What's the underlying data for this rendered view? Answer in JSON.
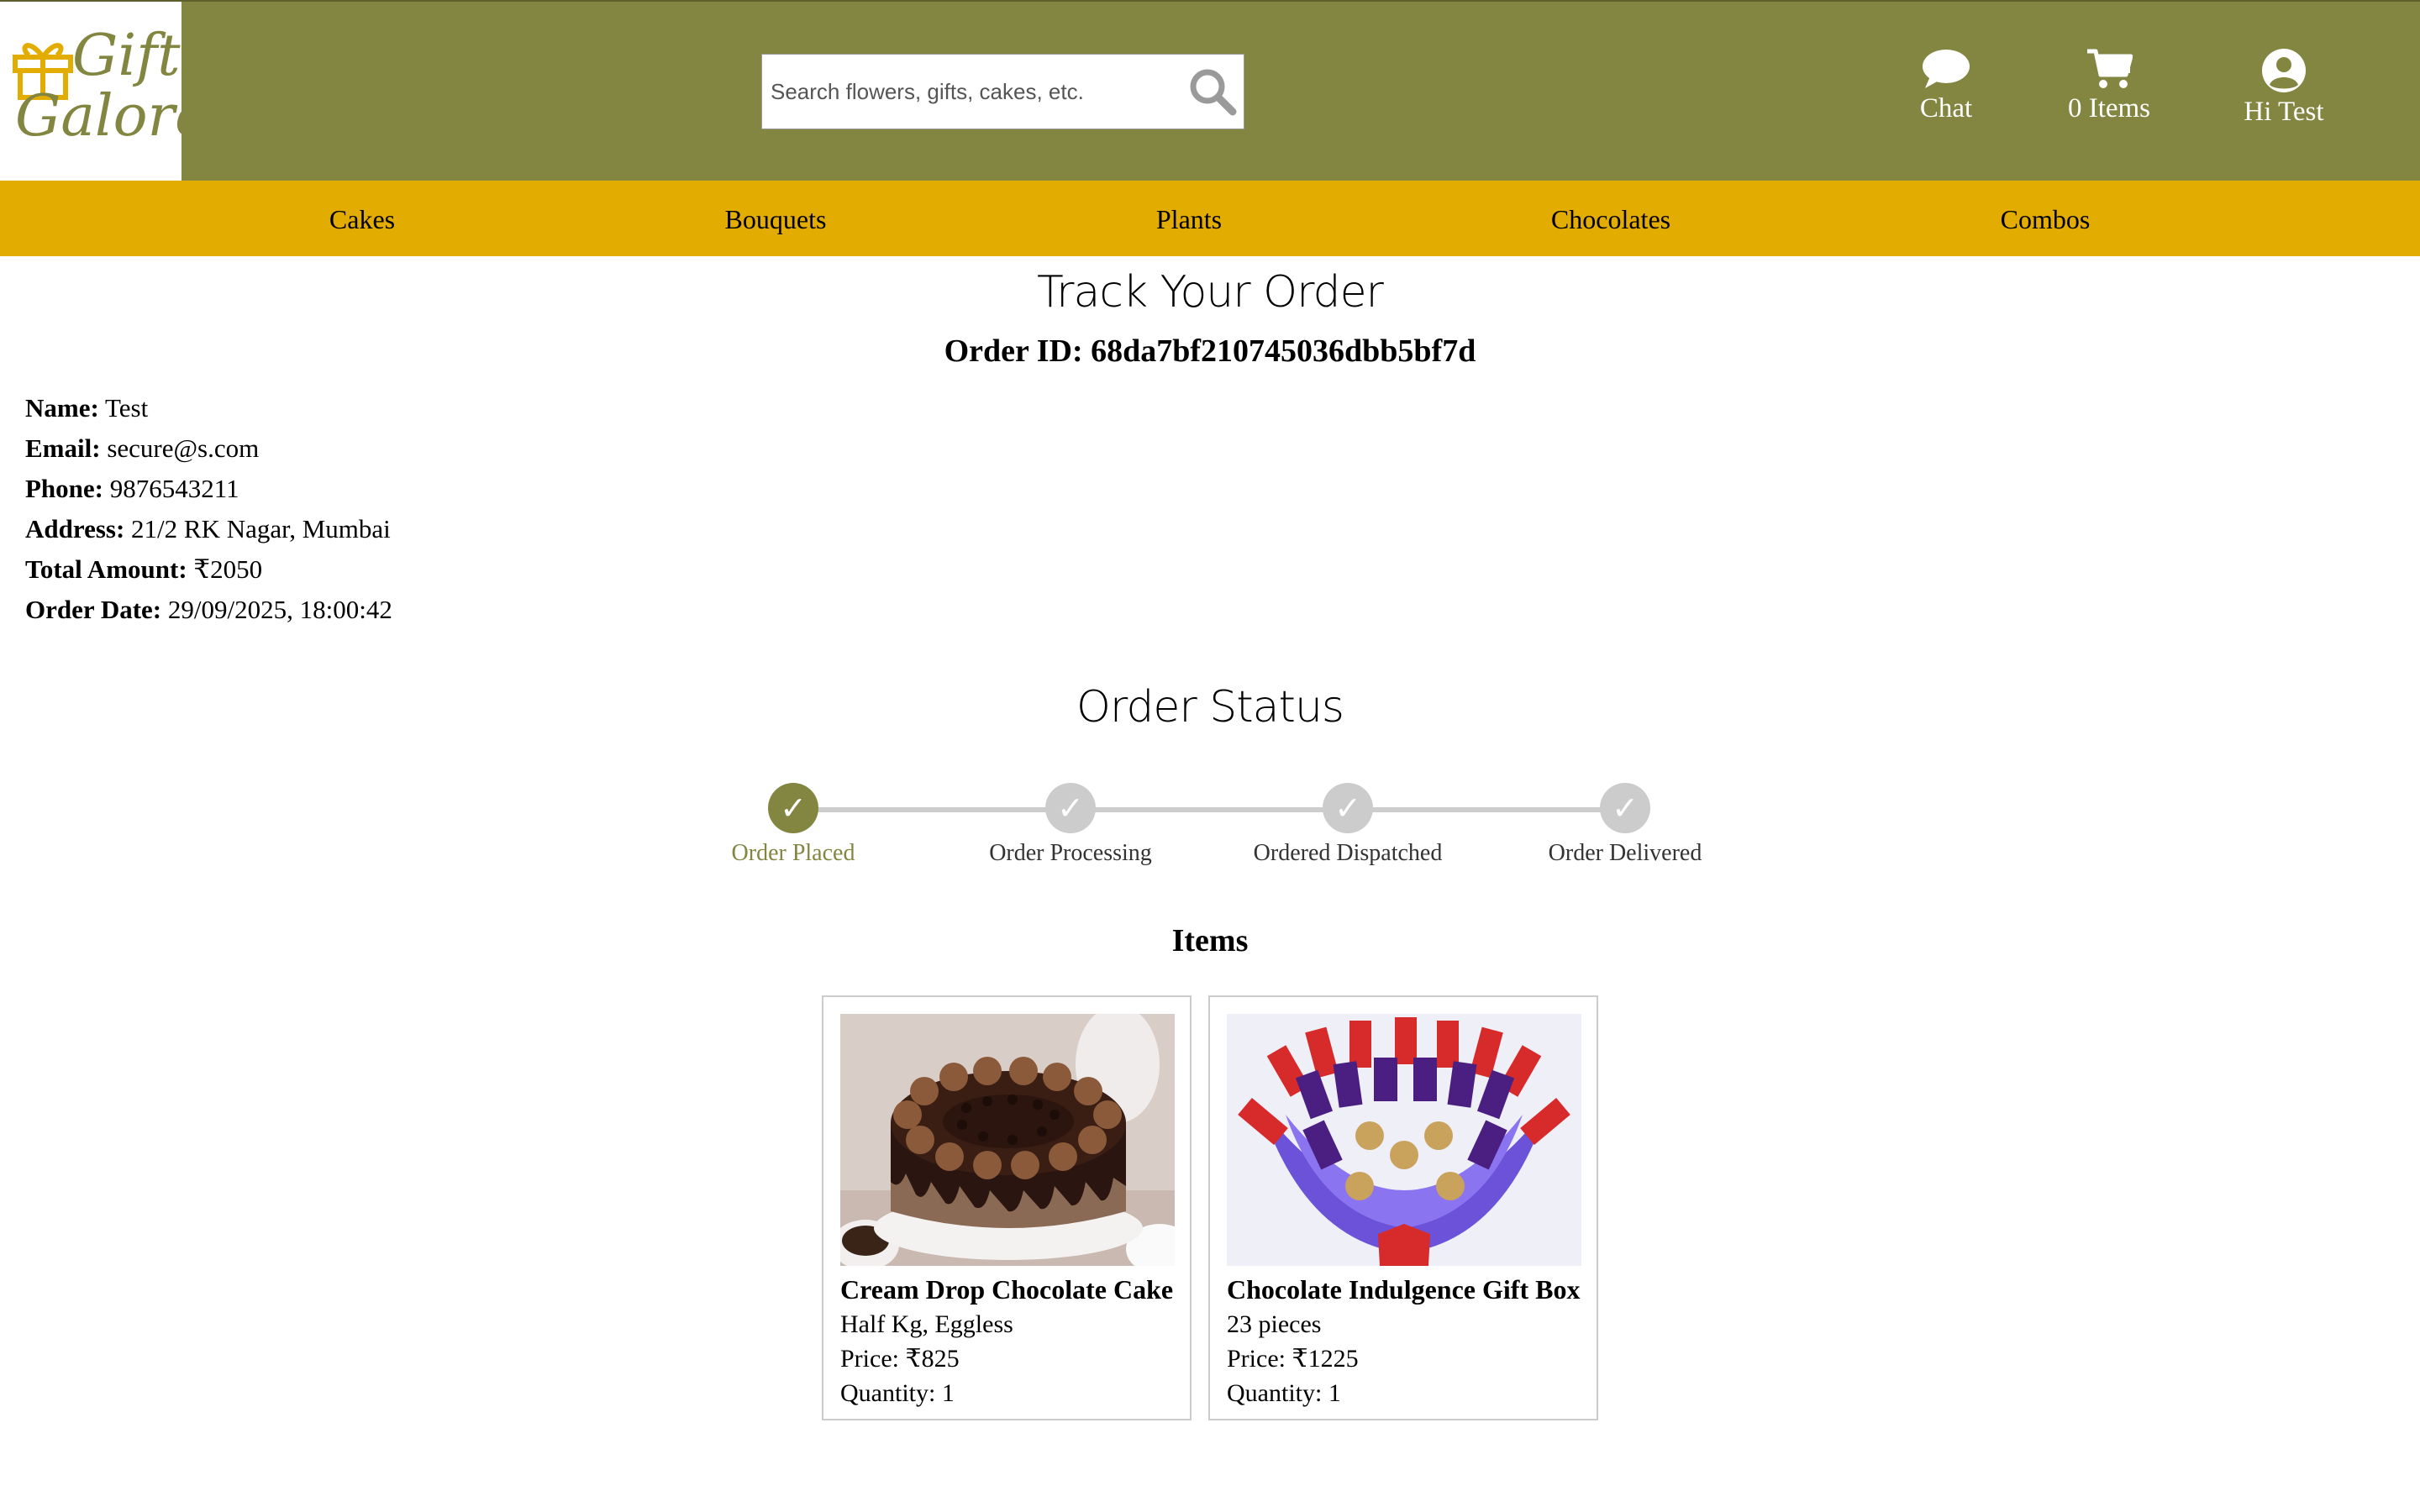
{
  "header": {
    "logo_line1": "Gift",
    "logo_line2": "Galore",
    "search_placeholder": "Search flowers, gifts, cakes, etc.",
    "chat_label": "Chat",
    "cart_label": "0 Items",
    "user_label": "Hi Test"
  },
  "categories": [
    "Cakes",
    "Bouquets",
    "Plants",
    "Chocolates",
    "Combos"
  ],
  "page": {
    "title": "Track Your Order",
    "order_id": "Order ID: 68da7bf210745036dbb5bf7d"
  },
  "details": [
    {
      "label": "Name:",
      "value": "Test"
    },
    {
      "label": "Email:",
      "value": "secure@s.com"
    },
    {
      "label": "Phone:",
      "value": "9876543211"
    },
    {
      "label": "Address:",
      "value": "21/2 RK Nagar, Mumbai"
    },
    {
      "label": "Total Amount:",
      "value": "₹2050"
    },
    {
      "label": "Order Date:",
      "value": "29/09/2025, 18:00:42"
    }
  ],
  "status": {
    "title": "Order Status",
    "steps": [
      {
        "label": "Order Placed",
        "completed": true
      },
      {
        "label": "Order Processing",
        "completed": false
      },
      {
        "label": "Ordered Dispatched",
        "completed": false
      },
      {
        "label": "Order Delivered",
        "completed": false
      }
    ],
    "check_glyph": "✓"
  },
  "items_title": "Items",
  "items": [
    {
      "name": "Cream Drop Chocolate Cake",
      "variant": "Half Kg, Eggless",
      "price": "Price: ₹825",
      "quantity": "Quantity: 1"
    },
    {
      "name": "Chocolate Indulgence Gift Box",
      "variant": "23 pieces",
      "price": "Price: ₹1225",
      "quantity": "Quantity: 1"
    }
  ],
  "colors": {
    "header_bg": "#838640",
    "category_bar_bg": "#e3ac00",
    "accent": "#838640",
    "inactive_step": "#cccccc"
  }
}
